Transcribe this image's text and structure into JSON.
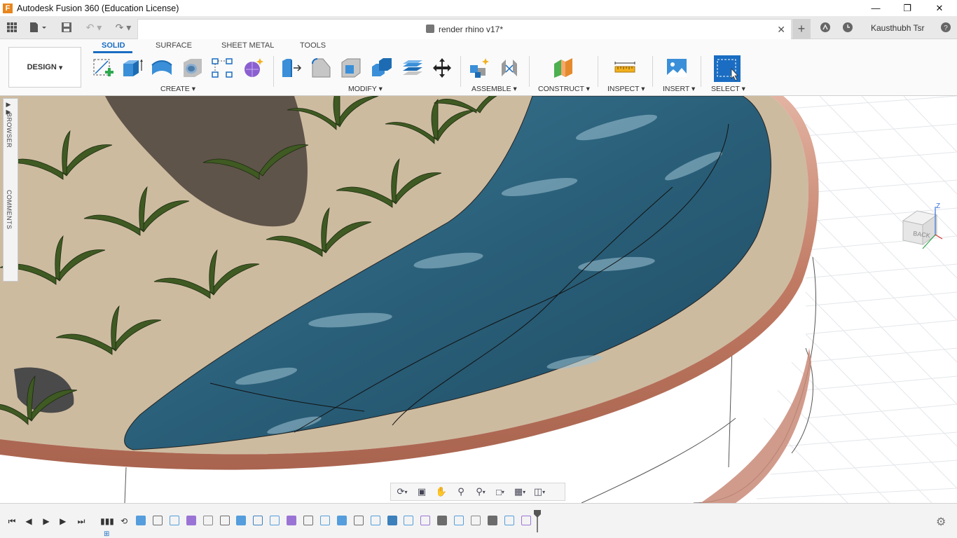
{
  "window": {
    "title": "Autodesk Fusion 360 (Education License)",
    "app_icon": "F"
  },
  "tabs": {
    "document_title": "render rhino v17*",
    "close": "✕",
    "new_tab": "+",
    "user": "Kausthubh Tsr"
  },
  "toolbar": {
    "workspace": "DESIGN",
    "workspace_tabs": [
      "SOLID",
      "SURFACE",
      "SHEET METAL",
      "TOOLS"
    ],
    "groups": {
      "create": "CREATE",
      "modify": "MODIFY",
      "assemble": "ASSEMBLE",
      "construct": "CONSTRUCT",
      "inspect": "INSPECT",
      "insert": "INSERT",
      "select": "SELECT"
    }
  },
  "side_panel": {
    "browser": "BROWSER",
    "comments": "COMMENTS"
  },
  "viewcube": {
    "face": "BACK",
    "axis_z": "Z"
  },
  "colors": {
    "accent": "#1a6dc2",
    "water": "#2e6a86",
    "copper_rim": "#c98a78",
    "sand": "#cdbba0"
  }
}
